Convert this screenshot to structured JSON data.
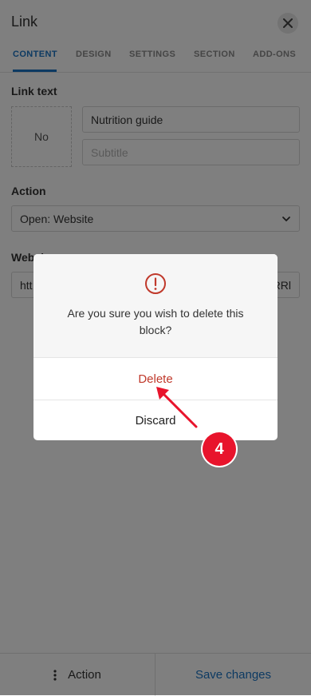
{
  "panel": {
    "title": "Link",
    "close_icon": "close-icon"
  },
  "tabs": [
    {
      "label": "CONTENT",
      "active": true
    },
    {
      "label": "DESIGN",
      "active": false
    },
    {
      "label": "SETTINGS",
      "active": false
    },
    {
      "label": "SECTION",
      "active": false
    },
    {
      "label": "ADD-ONS",
      "active": false
    }
  ],
  "link_text": {
    "label": "Link text",
    "image_placeholder": "No",
    "title_value": "Nutrition guide",
    "subtitle_placeholder": "Subtitle"
  },
  "action": {
    "label": "Action",
    "selected": "Open: Website"
  },
  "website": {
    "label_partial": "Websi",
    "value_start": "htt",
    "value_end": "RRl"
  },
  "dialog": {
    "icon": "warning-icon",
    "message": "Are you sure you wish to delete this block?",
    "delete_label": "Delete",
    "discard_label": "Discard"
  },
  "annotation": {
    "step": "4"
  },
  "bottom_bar": {
    "action_label": "Action",
    "save_label": "Save changes"
  },
  "colors": {
    "accent": "#1a74c4",
    "danger": "#c0392b",
    "badge": "#e8142c"
  }
}
